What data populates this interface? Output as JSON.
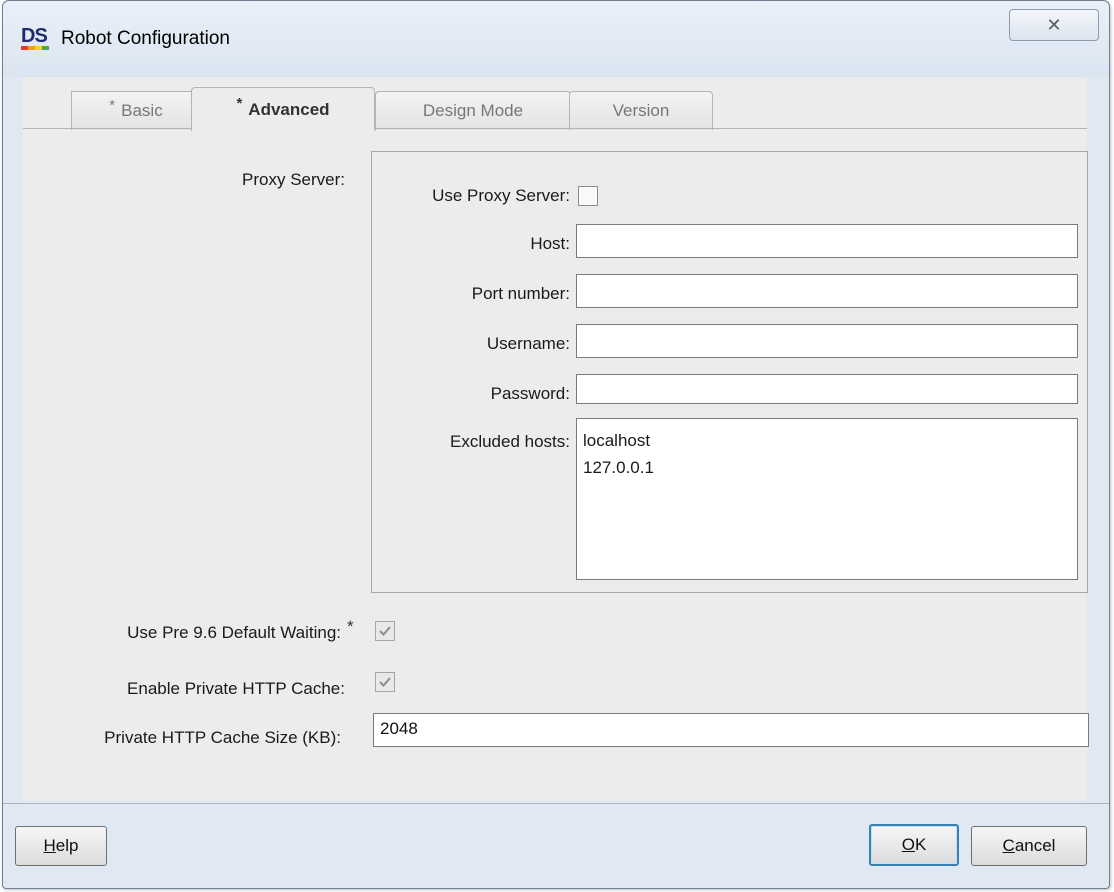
{
  "window": {
    "title": "Robot Configuration",
    "logo_text": "DS",
    "close_glyph": "✕"
  },
  "tabs": [
    {
      "label": "Basic",
      "modified": true,
      "active": false
    },
    {
      "label": "Advanced",
      "modified": true,
      "active": true
    },
    {
      "label": "Design Mode",
      "modified": false,
      "active": false
    },
    {
      "label": "Version",
      "modified": false,
      "active": false
    }
  ],
  "modified_marker": "*",
  "proxy": {
    "section_label": "Proxy Server:",
    "use_proxy_label": "Use Proxy Server:",
    "use_proxy_checked": false,
    "host_label": "Host:",
    "host_value": "",
    "port_label": "Port number:",
    "port_value": "",
    "username_label": "Username:",
    "username_value": "",
    "password_label": "Password:",
    "password_value": "",
    "excluded_label": "Excluded hosts:",
    "excluded_hosts": [
      "localhost",
      "127.0.0.1"
    ]
  },
  "options": {
    "pre96_label": "Use Pre 9.6 Default Waiting:",
    "pre96_checked": true,
    "private_cache_label": "Enable Private HTTP Cache:",
    "private_cache_checked": true,
    "cache_size_label": "Private HTTP Cache Size (KB):",
    "cache_size_value": "2048"
  },
  "buttons": {
    "help_mnemonic": "H",
    "help_rest": "elp",
    "ok_mnemonic": "O",
    "ok_rest": "K",
    "cancel_mnemonic": "C",
    "cancel_rest": "ancel"
  },
  "colors": {
    "window_bg": "#dfe8f3",
    "client_bg": "#ececec",
    "default_button_border": "#3c7fb1",
    "logo_stripes": [
      "#e23a2f",
      "#f39c1f",
      "#f7d21d",
      "#4aa84a"
    ]
  }
}
